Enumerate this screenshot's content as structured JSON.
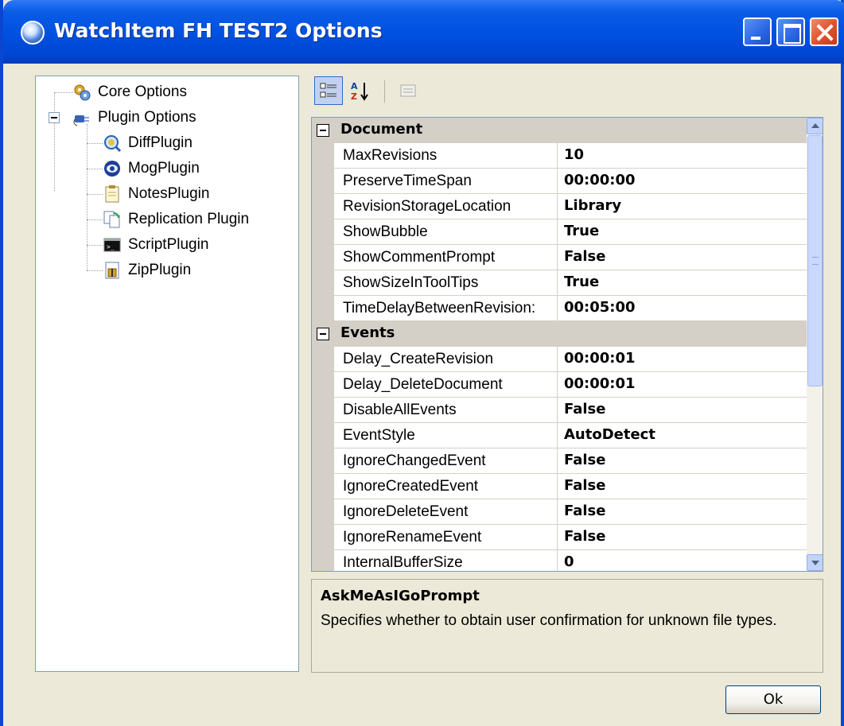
{
  "window": {
    "title": "WatchItem FH TEST2 Options",
    "controls": [
      "minimize",
      "maximize",
      "close"
    ]
  },
  "tree": {
    "items": [
      {
        "label": "Core Options",
        "icon": "gears-icon",
        "level": 0
      },
      {
        "label": "Plugin Options",
        "icon": "plug-icon",
        "level": 0,
        "expanded": true
      },
      {
        "label": "DiffPlugin",
        "icon": "magnifier-icon",
        "level": 1
      },
      {
        "label": "MogPlugin",
        "icon": "globe-icon",
        "level": 1
      },
      {
        "label": "NotesPlugin",
        "icon": "notepad-icon",
        "level": 1
      },
      {
        "label": "Replication Plugin",
        "icon": "replicate-icon",
        "level": 1
      },
      {
        "label": "ScriptPlugin",
        "icon": "console-icon",
        "level": 1
      },
      {
        "label": "ZipPlugin",
        "icon": "zip-icon",
        "level": 1
      }
    ]
  },
  "toolbar": {
    "categorized_label": "Categorized",
    "alphabetical_label": "A Z",
    "pages_label": "Property Pages"
  },
  "grid": {
    "categories": [
      {
        "name": "Document",
        "properties": [
          {
            "name": "MaxRevisions",
            "value": "10"
          },
          {
            "name": "PreserveTimeSpan",
            "value": "00:00:00"
          },
          {
            "name": "RevisionStorageLocation",
            "value": "Library"
          },
          {
            "name": "ShowBubble",
            "value": "True"
          },
          {
            "name": "ShowCommentPrompt",
            "value": "False"
          },
          {
            "name": "ShowSizeInToolTips",
            "value": "True"
          },
          {
            "name": "TimeDelayBetweenRevision:",
            "value": "00:05:00"
          }
        ]
      },
      {
        "name": "Events",
        "properties": [
          {
            "name": "Delay_CreateRevision",
            "value": "00:00:01"
          },
          {
            "name": "Delay_DeleteDocument",
            "value": "00:00:01"
          },
          {
            "name": "DisableAllEvents",
            "value": "False"
          },
          {
            "name": "EventStyle",
            "value": "AutoDetect"
          },
          {
            "name": "IgnoreChangedEvent",
            "value": "False"
          },
          {
            "name": "IgnoreCreatedEvent",
            "value": "False"
          },
          {
            "name": "IgnoreDeleteEvent",
            "value": "False"
          },
          {
            "name": "IgnoreRenameEvent",
            "value": "False"
          },
          {
            "name": "InternalBufferSize",
            "value": "0"
          }
        ]
      }
    ]
  },
  "description": {
    "title": "AskMeAsIGoPrompt",
    "text": "Specifies whether to obtain user confirmation for unknown file types."
  },
  "buttons": {
    "ok_label": "Ok"
  },
  "colors": {
    "titlebar": "#0050e0",
    "window_bg": "#ece9d8",
    "grid_category_bg": "#d4d0c8",
    "tree_border": "#7f9db9"
  }
}
